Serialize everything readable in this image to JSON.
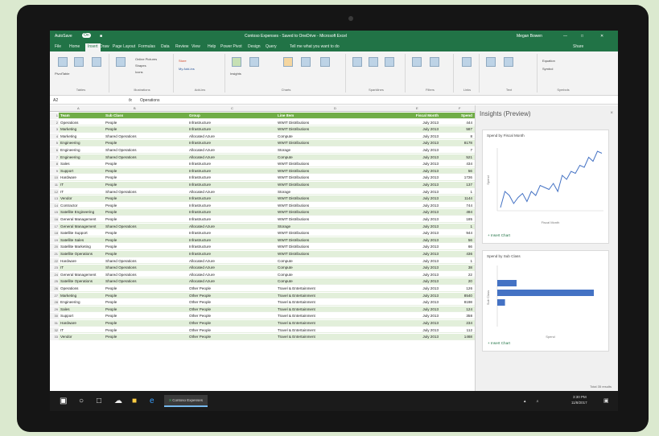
{
  "window": {
    "title": "Contoso Expenses - Saved to OneDrive - Microsoft Excel",
    "autosave": "AutoSave",
    "autosave_state": "On",
    "user": "Megan Bowen",
    "share": "Share"
  },
  "ribbon": {
    "tabs": [
      "File",
      "Home",
      "Insert",
      "Draw",
      "Page Layout",
      "Formulas",
      "Data",
      "Review",
      "View",
      "Help",
      "Power Pivot",
      "Design",
      "Query"
    ],
    "active_tab": "Insert",
    "tell_me": "Tell me what you want to do",
    "groups": [
      "Tables",
      "Illustrations",
      "Add-ins",
      "Charts",
      "Tours",
      "Sparklines",
      "Filters",
      "Links",
      "Text",
      "Symbols"
    ],
    "buttons": [
      "PivotTable",
      "Recommended PivotTables",
      "Table",
      "Pictures",
      "Online Pictures",
      "Shapes",
      "Icons",
      "Store",
      "My Add-ins",
      "Insights",
      "Recommended Charts",
      "Maps",
      "PivotChart",
      "3D Map",
      "Line",
      "Column",
      "Win/Loss",
      "Slicer",
      "Timeline",
      "Link",
      "Text Box",
      "Header & Footer",
      "Equation",
      "Symbol"
    ]
  },
  "formula_bar": {
    "cell": "A2",
    "fx": "fx",
    "value": "Operations"
  },
  "columns": [
    "A",
    "B",
    "C",
    "D",
    "E",
    "F"
  ],
  "table": {
    "headers": [
      "Team",
      "Sub Class",
      "Group",
      "Line Item",
      "Fiscal Month",
      "Spend"
    ],
    "rows": [
      [
        "Operations",
        "People",
        "Infrastructure",
        "WWIT Distributions",
        "July 2013",
        "444"
      ],
      [
        "Marketing",
        "People",
        "Infrastructure",
        "WWIT Distributions",
        "July 2013",
        "587"
      ],
      [
        "Marketing",
        "Shared Operations",
        "Allocated Azure",
        "Compute",
        "July 2013",
        "8"
      ],
      [
        "Engineering",
        "People",
        "Infrastructure",
        "WWIT Distributions",
        "July 2013",
        "8178"
      ],
      [
        "Engineering",
        "Shared Operations",
        "Allocated Azure",
        "Storage",
        "July 2013",
        "7"
      ],
      [
        "Engineering",
        "Shared Operations",
        "Allocated Azure",
        "Compute",
        "July 2013",
        "521"
      ],
      [
        "Sales",
        "People",
        "Infrastructure",
        "WWIT Distributions",
        "July 2013",
        "434"
      ],
      [
        "Support",
        "People",
        "Infrastructure",
        "WWIT Distributions",
        "July 2013",
        "56"
      ],
      [
        "Hardware",
        "People",
        "Infrastructure",
        "WWIT Distributions",
        "July 2013",
        "1726"
      ],
      [
        "IT",
        "People",
        "Infrastructure",
        "WWIT Distributions",
        "July 2013",
        "137"
      ],
      [
        "IT",
        "Shared Operations",
        "Allocated Azure",
        "Storage",
        "July 2013",
        "1"
      ],
      [
        "Vendor",
        "People",
        "Infrastructure",
        "WWIT Distributions",
        "July 2013",
        "1144"
      ],
      [
        "Contractor",
        "People",
        "Infrastructure",
        "WWIT Distributions",
        "July 2013",
        "744"
      ],
      [
        "Satellite Engineering",
        "People",
        "Infrastructure",
        "WWIT Distributions",
        "July 2013",
        "494"
      ],
      [
        "General Management",
        "People",
        "Infrastructure",
        "WWIT Distributions",
        "July 2013",
        "185"
      ],
      [
        "General Management",
        "Shared Operations",
        "Allocated Azure",
        "Storage",
        "July 2013",
        "1"
      ],
      [
        "Satellite Support",
        "People",
        "Infrastructure",
        "WWIT Distributions",
        "July 2013",
        "944"
      ],
      [
        "Satellite Sales",
        "People",
        "Infrastructure",
        "WWIT Distributions",
        "July 2013",
        "56"
      ],
      [
        "Satellite Marketing",
        "People",
        "Infrastructure",
        "WWIT Distributions",
        "July 2013",
        "66"
      ],
      [
        "Satellite Operations",
        "People",
        "Infrastructure",
        "WWIT Distributions",
        "July 2013",
        "436"
      ],
      [
        "Hardware",
        "Shared Operations",
        "Allocated Azure",
        "Compute",
        "July 2013",
        "1"
      ],
      [
        "IT",
        "Shared Operations",
        "Allocated Azure",
        "Compute",
        "July 2013",
        "38"
      ],
      [
        "General Management",
        "Shared Operations",
        "Allocated Azure",
        "Compute",
        "July 2013",
        "22"
      ],
      [
        "Satellite Operations",
        "Shared Operations",
        "Allocated Azure",
        "Compute",
        "July 2013",
        "20"
      ],
      [
        "Operations",
        "People",
        "Other People",
        "Travel & Entertainment",
        "July 2013",
        "126"
      ],
      [
        "Marketing",
        "People",
        "Other People",
        "Travel & Entertainment",
        "July 2013",
        "8540"
      ],
      [
        "Engineering",
        "People",
        "Other People",
        "Travel & Entertainment",
        "July 2013",
        "8198"
      ],
      [
        "Sales",
        "People",
        "Other People",
        "Travel & Entertainment",
        "July 2013",
        "124"
      ],
      [
        "Support",
        "People",
        "Other People",
        "Travel & Entertainment",
        "July 2013",
        "358"
      ],
      [
        "Hardware",
        "People",
        "Other People",
        "Travel & Entertainment",
        "July 2013",
        "234"
      ],
      [
        "IT",
        "People",
        "Other People",
        "Travel & Entertainment",
        "July 2013",
        "112"
      ],
      [
        "Vendor",
        "People",
        "Other People",
        "Travel & Entertainment",
        "July 2013",
        "1468"
      ]
    ]
  },
  "sheet_tab": "Expenses",
  "insights": {
    "title": "Insights (Preview)",
    "close": "×",
    "card1": {
      "title": "Spend by Fiscal Month",
      "xlabel": "Fiscal Month",
      "ylabel": "Spend",
      "insert": "+ Insert Chart"
    },
    "card2": {
      "title": "Spend by Sub Class",
      "xlabel": "Spend",
      "ylabel": "Sub Class",
      "insert": "+ Insert Chart"
    },
    "footer": "Total 35 results"
  },
  "status": {
    "left": "Ready",
    "display": "Display Settings",
    "zoom": "100%"
  },
  "taskbar": {
    "app": "Contoso Expenses",
    "time": "3:30 PM",
    "date": "11/8/2017"
  },
  "chart_data": [
    {
      "type": "line",
      "title": "Spend by Fiscal Month",
      "xlabel": "Fiscal Month",
      "ylabel": "Spend",
      "values": [
        52,
        60,
        58,
        54,
        57,
        59,
        55,
        60,
        58,
        63,
        62,
        61,
        64,
        60,
        68,
        66,
        70,
        69,
        73,
        72,
        77,
        75,
        80,
        79
      ]
    },
    {
      "type": "bar",
      "title": "Spend by Sub Class",
      "xlabel": "Spend",
      "ylabel": "Sub Class",
      "values": [
        20,
        100,
        8
      ]
    }
  ]
}
